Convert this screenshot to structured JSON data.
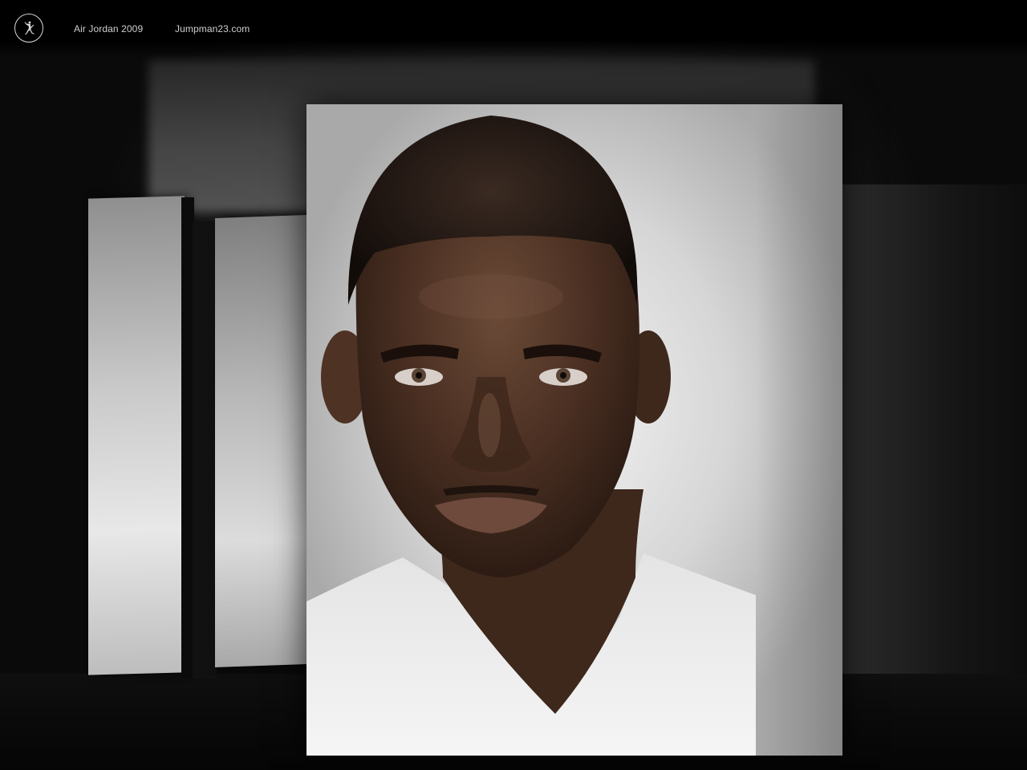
{
  "nav": {
    "logo_icon": "jumpman-icon",
    "links": [
      {
        "label": "Air Jordan 2009"
      },
      {
        "label": "Jumpman23.com"
      }
    ]
  },
  "gallery": {
    "main_photo_icon": "portrait-photo",
    "side_panels": 2
  },
  "colors": {
    "background": "#070707",
    "nav_text": "#cfcfcf",
    "logo_ring": "#d9d9d9"
  }
}
